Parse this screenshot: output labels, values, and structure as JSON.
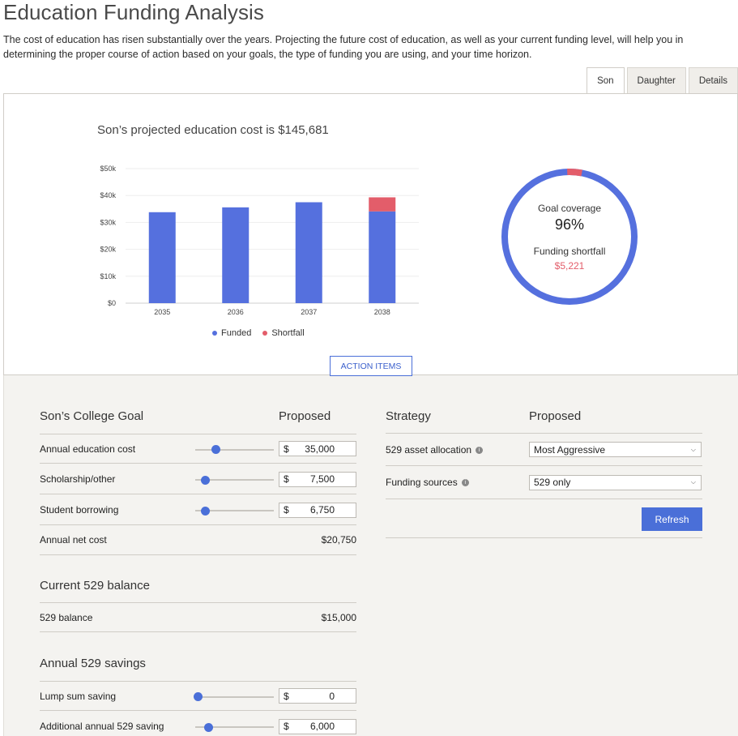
{
  "page": {
    "title": "Education Funding Analysis",
    "intro": "The cost of education has risen substantially over the years. Projecting the future cost of education, as well as your current funding level, will help you in determining the proper course of action based on your goals, the type of funding you are using, and your time horizon."
  },
  "tabs": [
    {
      "label": "Son",
      "active": true
    },
    {
      "label": "Daughter",
      "active": false
    },
    {
      "label": "Details",
      "active": false
    }
  ],
  "chart_heading": "Son’s projected education cost is $145,681",
  "chart_data": {
    "type": "bar",
    "stacked": true,
    "categories": [
      "2035",
      "2036",
      "2037",
      "2038"
    ],
    "series": [
      {
        "name": "Funded",
        "values": [
          33800,
          35600,
          37500,
          34100
        ],
        "color": "#5570de"
      },
      {
        "name": "Shortfall",
        "values": [
          0,
          0,
          0,
          5221
        ],
        "color": "#e35d6a"
      }
    ],
    "ylim": [
      0,
      50000
    ],
    "yticks": [
      0,
      10000,
      20000,
      30000,
      40000,
      50000
    ],
    "ytick_labels": [
      "$0",
      "$10k",
      "$20k",
      "$30k",
      "$40k",
      "$50k"
    ],
    "grid": true,
    "legend": "bottom"
  },
  "donut": {
    "coverage_label": "Goal coverage",
    "coverage_value": "96%",
    "coverage_fraction": 0.964,
    "shortfall_label": "Funding shortfall",
    "shortfall_value": "$5,221",
    "funded_color": "#5570de",
    "shortfall_color": "#e35d6a"
  },
  "action_button": "ACTION ITEMS",
  "goal": {
    "heading": "Son’s College Goal",
    "proposed": "Proposed",
    "rows": [
      {
        "label": "Annual education cost",
        "currency": "$",
        "value": "35,000",
        "slider": 0.23
      },
      {
        "label": "Scholarship/other",
        "currency": "$",
        "value": "7,500",
        "slider": 0.09
      },
      {
        "label": "Student borrowing",
        "currency": "$",
        "value": "6,750",
        "slider": 0.09
      }
    ],
    "net_label": "Annual net cost",
    "net_value": "$20,750"
  },
  "balance": {
    "heading": "Current 529 balance",
    "label": "529 balance",
    "value": "$15,000"
  },
  "savings": {
    "heading": "Annual 529 savings",
    "rows": [
      {
        "label": "Lump sum saving",
        "currency": "$",
        "value": "0",
        "slider": 0.0
      },
      {
        "label": "Additional annual 529 saving",
        "currency": "$",
        "value": "6,000",
        "slider": 0.13
      }
    ]
  },
  "strategy": {
    "heading": "Strategy",
    "proposed": "Proposed",
    "rows": [
      {
        "label": "529 asset allocation",
        "value": "Most Aggressive"
      },
      {
        "label": "Funding sources",
        "value": "529 only"
      }
    ],
    "refresh_label": "Refresh"
  },
  "colors": {
    "accent": "#4a6fd8",
    "shortfall": "#e35d6a",
    "panel_bg": "#f4f3f0"
  }
}
